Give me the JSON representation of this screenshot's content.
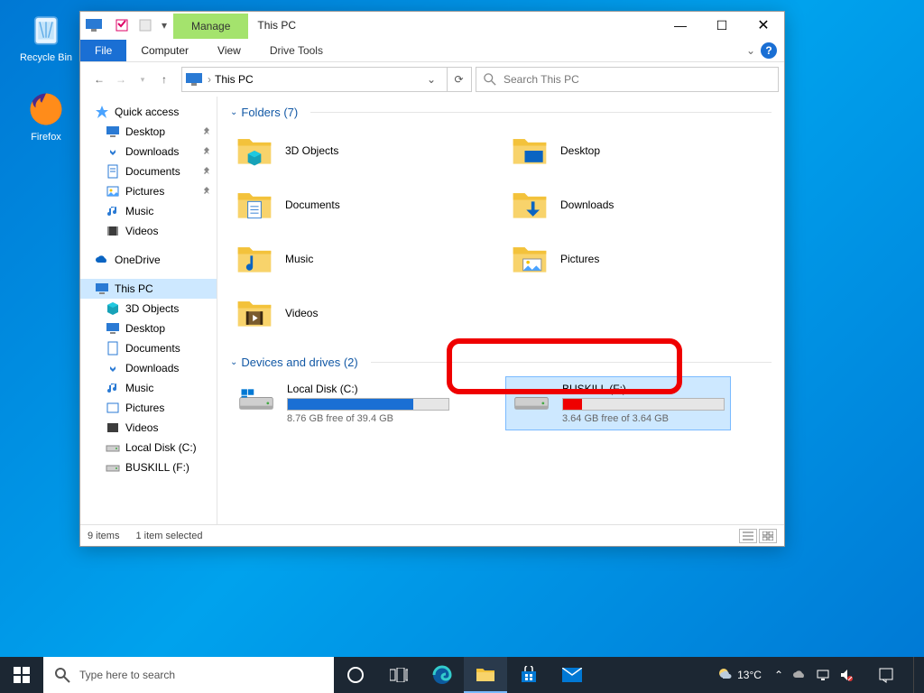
{
  "desktop": {
    "recycle_bin": "Recycle Bin",
    "firefox": "Firefox"
  },
  "explorer": {
    "qat_manage": "Manage",
    "title": "This PC",
    "ribbon": {
      "file": "File",
      "computer": "Computer",
      "view": "View",
      "drive_tools": "Drive Tools"
    },
    "address": "This PC",
    "search_placeholder": "Search This PC",
    "nav": {
      "quick_access": "Quick access",
      "desktop": "Desktop",
      "downloads": "Downloads",
      "documents": "Documents",
      "pictures": "Pictures",
      "music": "Music",
      "videos": "Videos",
      "onedrive": "OneDrive",
      "this_pc": "This PC",
      "objects3d": "3D Objects",
      "local_disk": "Local Disk (C:)",
      "buskill": "BUSKILL (F:)"
    },
    "sections": {
      "folders": "Folders (7)",
      "drives": "Devices and drives (2)"
    },
    "folders": {
      "objects3d": "3D Objects",
      "desktop": "Desktop",
      "documents": "Documents",
      "downloads": "Downloads",
      "music": "Music",
      "pictures": "Pictures",
      "videos": "Videos"
    },
    "drives": {
      "local": {
        "name": "Local Disk (C:)",
        "free": "8.76 GB free of 39.4 GB",
        "used_pct": 78,
        "fill_color": "#1a6fd4"
      },
      "buskill": {
        "name": "BUSKILL (F:)",
        "free": "3.64 GB free of 3.64 GB",
        "used_pct": 12,
        "fill_color": "#ef0000"
      }
    },
    "status": {
      "items": "9 items",
      "selected": "1 item selected"
    }
  },
  "taskbar": {
    "search_placeholder": "Type here to search",
    "weather_temp": "13°C"
  }
}
